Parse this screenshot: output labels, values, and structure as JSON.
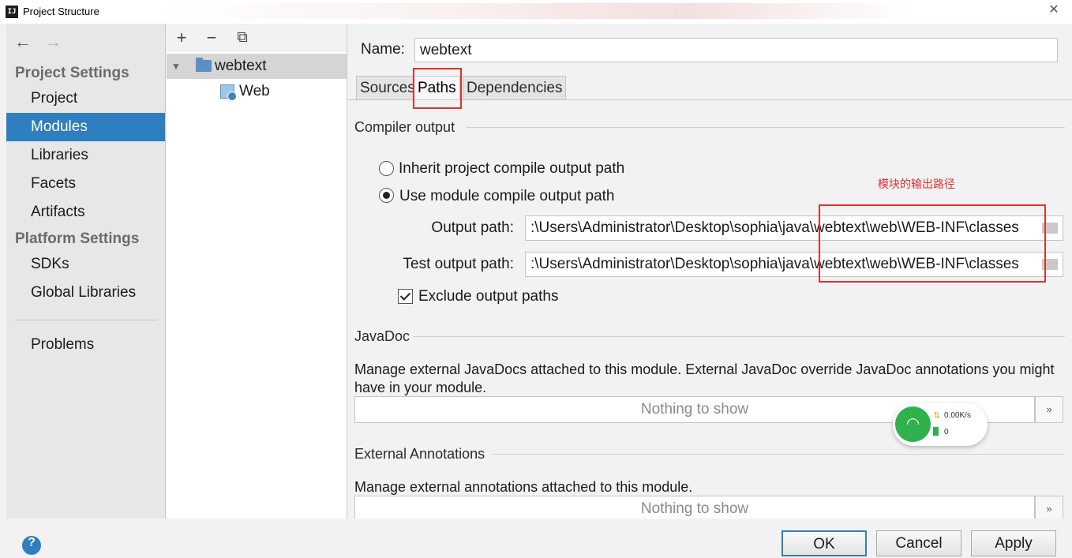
{
  "window": {
    "title": "Project Structure",
    "app_icon": "IJ",
    "close_glyph": "✕"
  },
  "nav": {
    "back_glyph": "←",
    "forward_glyph": "→",
    "project_settings_heading": "Project Settings",
    "project_settings_items": [
      "Project",
      "Modules",
      "Libraries",
      "Facets",
      "Artifacts"
    ],
    "selected_item": "Modules",
    "platform_settings_heading": "Platform Settings",
    "platform_items": [
      "SDKs",
      "Global Libraries"
    ],
    "problems_label": "Problems"
  },
  "tree": {
    "toolbar": {
      "add_glyph": "+",
      "remove_glyph": "−",
      "copy_glyph": "⧉"
    },
    "root_label": "webtext",
    "child_label": "Web",
    "expand_glyph": "▼"
  },
  "module": {
    "name_label": "Name:",
    "name_value": "webtext",
    "tabs": [
      "Sources",
      "Paths",
      "Dependencies"
    ],
    "active_tab": "Paths"
  },
  "compiler_output": {
    "heading": "Compiler output",
    "inherit_option": "Inherit project compile output path",
    "use_module_option": "Use module compile output path",
    "selected_option": "use_module",
    "output_path_label": "Output path:",
    "output_path_value": ":\\Users\\Administrator\\Desktop\\sophia\\java\\webtext\\web\\WEB-INF\\classes",
    "test_output_path_label": "Test output path:",
    "test_output_path_value": ":\\Users\\Administrator\\Desktop\\sophia\\java\\webtext\\web\\WEB-INF\\classes",
    "exclude_label": "Exclude output paths",
    "exclude_checked": true
  },
  "javadoc": {
    "heading": "JavaDoc",
    "description": "Manage external JavaDocs attached to this module. External JavaDoc override JavaDoc annotations you might have in your module.",
    "empty_text": "Nothing to show",
    "more_glyph": "»"
  },
  "external_annotations": {
    "heading": "External Annotations",
    "description": "Manage external annotations attached to this module.",
    "empty_text": "Nothing to show",
    "more_glyph": "»"
  },
  "annotation": {
    "text": "模块的输出路径",
    "color": "#e03131"
  },
  "network_widget": {
    "speed": "0.00K/s",
    "count": "0"
  },
  "buttons": {
    "help": "?",
    "ok": "OK",
    "cancel": "Cancel",
    "apply": "Apply"
  },
  "colors": {
    "selection": "#2f7ec0",
    "annotation": "#e03131",
    "wifi": "#2fb24e"
  }
}
